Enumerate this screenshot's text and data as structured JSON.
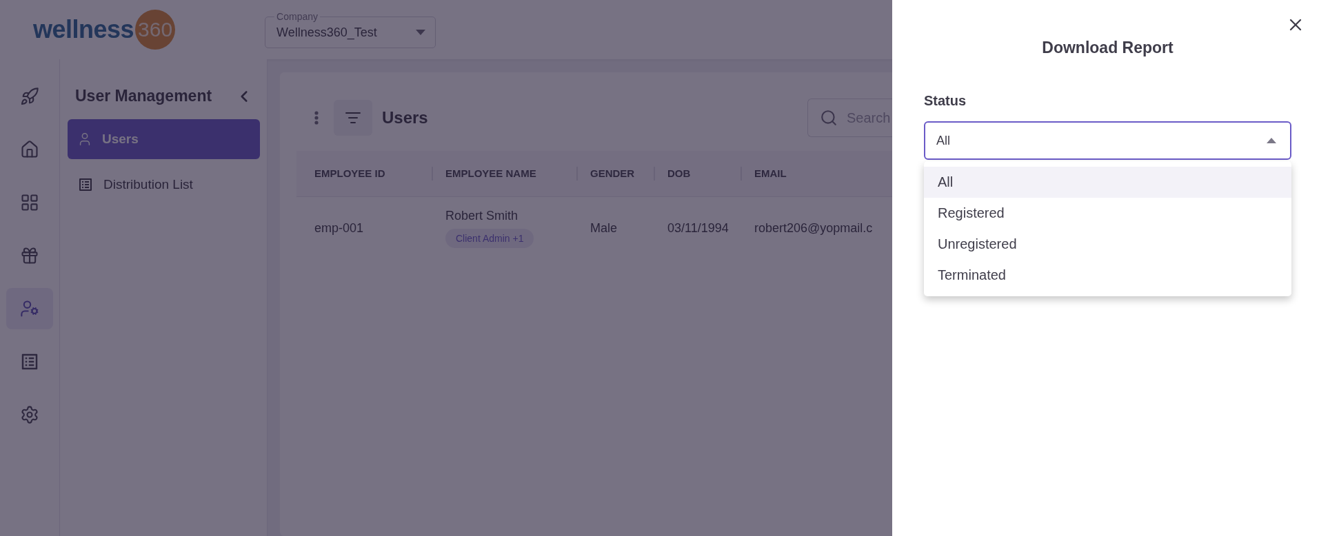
{
  "header": {
    "logo": {
      "word": "wellness",
      "number": "360"
    },
    "company_select": {
      "label": "Company",
      "value": "Wellness360_Test"
    }
  },
  "rail": [
    {
      "selected": false
    },
    {
      "selected": false
    },
    {
      "selected": false
    },
    {
      "selected": false
    },
    {
      "selected": true
    },
    {
      "selected": false
    },
    {
      "selected": false
    }
  ],
  "submenu": {
    "title": "User Management",
    "items": [
      {
        "label": "Users",
        "selected": true
      },
      {
        "label": "Distribution List",
        "selected": false
      }
    ]
  },
  "users_panel": {
    "title": "Users",
    "search": {
      "placeholder": "Search"
    },
    "table": {
      "columns": [
        "EMPLOYEE ID",
        "EMPLOYEE NAME",
        "GENDER",
        "DOB",
        "EMAIL"
      ],
      "rows": [
        {
          "employee_id": "emp-001",
          "employee_name": "Robert Smith",
          "role_badge": "Client Admin +1",
          "gender": "Male",
          "dob": "03/11/1994",
          "email": "robert206@yopmail.c"
        }
      ]
    }
  },
  "drawer": {
    "title": "Download Report",
    "status_field": {
      "label": "Status",
      "value": "All",
      "expanded": true,
      "options": [
        {
          "label": "All",
          "selected": true
        },
        {
          "label": "Registered",
          "selected": false
        },
        {
          "label": "Unregistered",
          "selected": false
        },
        {
          "label": "Terminated",
          "selected": false
        }
      ]
    }
  }
}
